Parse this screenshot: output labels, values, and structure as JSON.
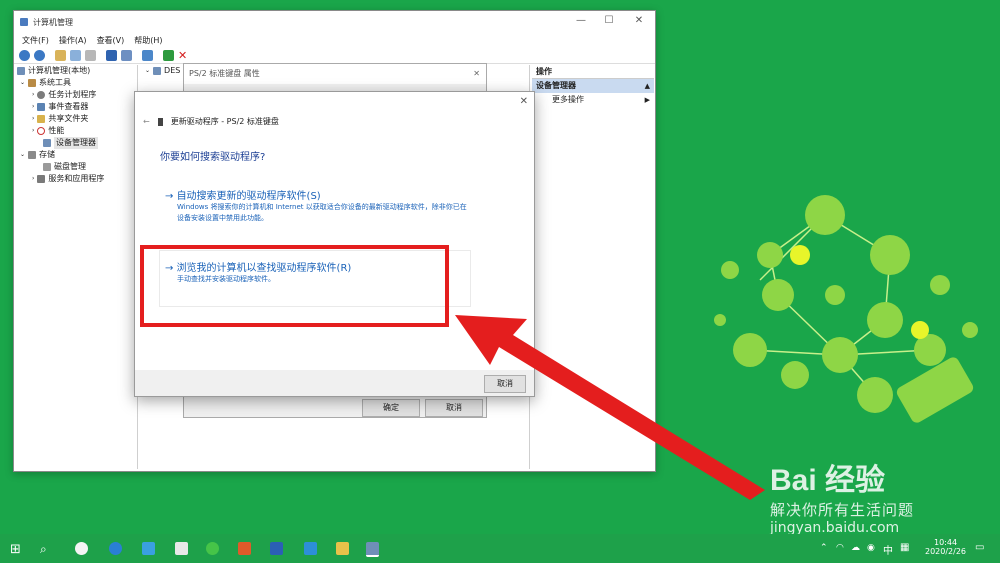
{
  "mmc": {
    "title": "计算机管理",
    "menu": [
      "文件(F)",
      "操作(A)",
      "查看(V)",
      "帮助(H)"
    ],
    "tree": [
      {
        "label": "计算机管理(本地)",
        "depth": 0
      },
      {
        "label": "系统工具",
        "depth": 1
      },
      {
        "label": "任务计划程序",
        "depth": 2
      },
      {
        "label": "事件查看器",
        "depth": 2
      },
      {
        "label": "共享文件夹",
        "depth": 2
      },
      {
        "label": "性能",
        "depth": 2
      },
      {
        "label": "设备管理器",
        "depth": 2,
        "selected": true
      },
      {
        "label": "存储",
        "depth": 1
      },
      {
        "label": "磁盘管理",
        "depth": 2
      },
      {
        "label": "服务和应用程序",
        "depth": 1
      }
    ],
    "middle_header": "DES",
    "actions": {
      "header": "操作",
      "selected": "设备管理器",
      "more": "更多操作"
    }
  },
  "props": {
    "title": "PS/2 标准键盘 属性",
    "ok": "确定",
    "cancel": "取消"
  },
  "wizard": {
    "title": "更新驱动程序 - PS/2 标准键盘",
    "question": "你要如何搜索驱动程序?",
    "option1": {
      "title": "自动搜索更新的驱动程序软件(S)",
      "desc": "Windows 将搜索你的计算机和 Internet 以获取适合你设备的最新驱动程序软件，除非你已在设备安装设置中禁用此功能。"
    },
    "option2": {
      "title": "浏览我的计算机以查找驱动程序软件(R)",
      "desc": "手动查找并安装驱动程序软件。"
    },
    "cancel": "取消"
  },
  "watermark": {
    "brand": "Bai 经验",
    "slogan": "解决你所有生活问题",
    "url": "jingyan.baidu.com"
  },
  "tray": {
    "ime": "中",
    "time": "10:44",
    "date": "2020/2/26"
  },
  "colors": {
    "desktop": "#1aa64a",
    "highlight": "#e41e1e",
    "link": "#1a62b8"
  }
}
